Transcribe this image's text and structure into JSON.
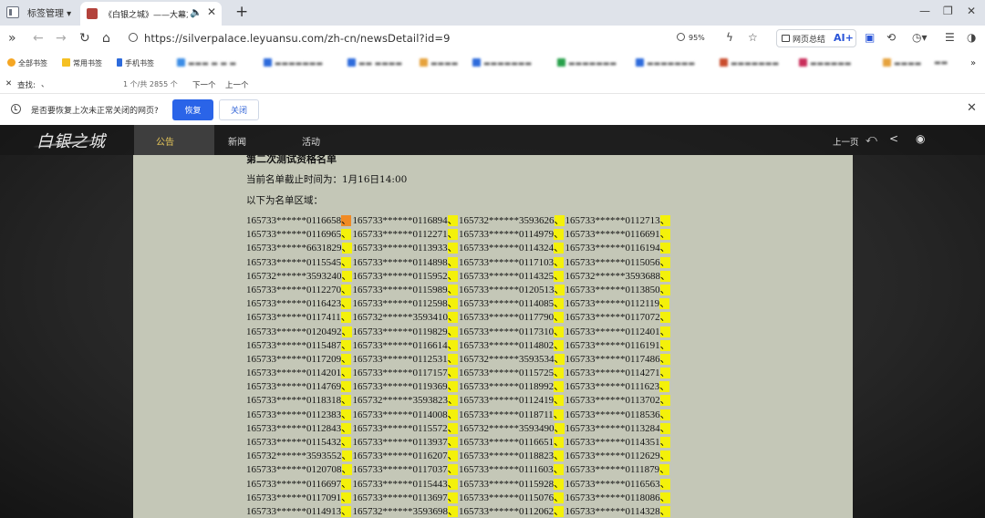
{
  "browser": {
    "tabs": [
      {
        "title": "标签管理"
      },
      {
        "title": "《白银之城》——大幕方启"
      }
    ],
    "url": "https://silverpalace.leyuansu.com/zh-cn/newsDetail?id=9",
    "zoom": "95%",
    "summary_label": "网页总结",
    "ai_label": "AI+",
    "bookmarks": [
      {
        "label": "全部书签",
        "color": "#f5a623"
      },
      {
        "label": "常用书签",
        "color": "#f5c023"
      },
      {
        "label": "手机书签",
        "color": "#2d6bdc"
      },
      {
        "label": "",
        "color": "#3c8de6"
      },
      {
        "label": "",
        "color": "#2d6bdc"
      },
      {
        "label": "",
        "color": "#2d6bdc"
      },
      {
        "label": "",
        "color": "#e6a23c"
      },
      {
        "label": "",
        "color": "#2d6bdc"
      },
      {
        "label": "",
        "color": "#27a04a"
      },
      {
        "label": "",
        "color": "#2d6bdc"
      },
      {
        "label": "",
        "color": "#c94d2d"
      },
      {
        "label": "",
        "color": "#c92d5a"
      },
      {
        "label": "",
        "color": "#e6a23c"
      }
    ],
    "find": {
      "label": "查找:",
      "query": "、",
      "count": "1 个/共 2855 个",
      "next": "下一个",
      "prev": "上一个"
    },
    "restore": {
      "message": "是否要恢复上次未正常关闭的网页?",
      "restore": "恢复",
      "close": "关闭"
    }
  },
  "site": {
    "nav": [
      "公告",
      "新闻",
      "活动"
    ],
    "active_nav": "公告",
    "prev_page": "上一页"
  },
  "article": {
    "title": "第二次测试资格名单",
    "deadline": "当前名单截止时间为：1月16日14:00",
    "intro": "以下为名单区域：",
    "rows": [
      [
        "165733******0116658",
        "165733******0116894",
        "165732******3593626",
        "165733******0112713"
      ],
      [
        "165733******0116965",
        "165733******0112271",
        "165733******0114979",
        "165733******0116691"
      ],
      [
        "165733******6631829",
        "165733******0113933",
        "165733******0114324",
        "165733******0116194"
      ],
      [
        "165733******0115545",
        "165733******0114898",
        "165733******0117103",
        "165733******0115056"
      ],
      [
        "165732******3593240",
        "165733******0115952",
        "165733******0114325",
        "165732******3593688"
      ],
      [
        "165733******0112270",
        "165733******0115989",
        "165733******0120513",
        "165733******0113850"
      ],
      [
        "165733******0116423",
        "165733******0112598",
        "165733******0114085",
        "165733******0112119"
      ],
      [
        "165733******0117411",
        "165732******3593410",
        "165733******0117790",
        "165733******0117072"
      ],
      [
        "165733******0120492",
        "165733******0119829",
        "165733******0117310",
        "165733******0112401"
      ],
      [
        "165733******0115487",
        "165733******0116614",
        "165733******0114802",
        "165733******0116191"
      ],
      [
        "165733******0117209",
        "165733******0112531",
        "165732******3593534",
        "165733******0117486"
      ],
      [
        "165733******0114201",
        "165733******0117157",
        "165733******0115725",
        "165733******0114271"
      ],
      [
        "165733******0114769",
        "165733******0119369",
        "165733******0118992",
        "165733******0111623"
      ],
      [
        "165733******0118318",
        "165732******3593823",
        "165733******0112419",
        "165733******0113702"
      ],
      [
        "165733******0112383",
        "165733******0114008",
        "165733******0118711",
        "165733******0118536"
      ],
      [
        "165733******0112843",
        "165733******0115572",
        "165732******3593490",
        "165733******0113284"
      ],
      [
        "165733******0115432",
        "165733******0113937",
        "165733******0116651",
        "165733******0114351"
      ],
      [
        "165732******3593552",
        "165733******0116207",
        "165733******0118823",
        "165733******0112629"
      ],
      [
        "165733******0120708",
        "165733******0117037",
        "165733******0111603",
        "165733******0111879"
      ],
      [
        "165733******0116697",
        "165733******0115443",
        "165733******0115928",
        "165733******0116563"
      ],
      [
        "165733******0117091",
        "165733******0113697",
        "165733******0115076",
        "165733******0118086"
      ],
      [
        "165733******0114913",
        "165732******3593698",
        "165733******0112062",
        "165733******0114328"
      ]
    ],
    "separator": "、"
  }
}
